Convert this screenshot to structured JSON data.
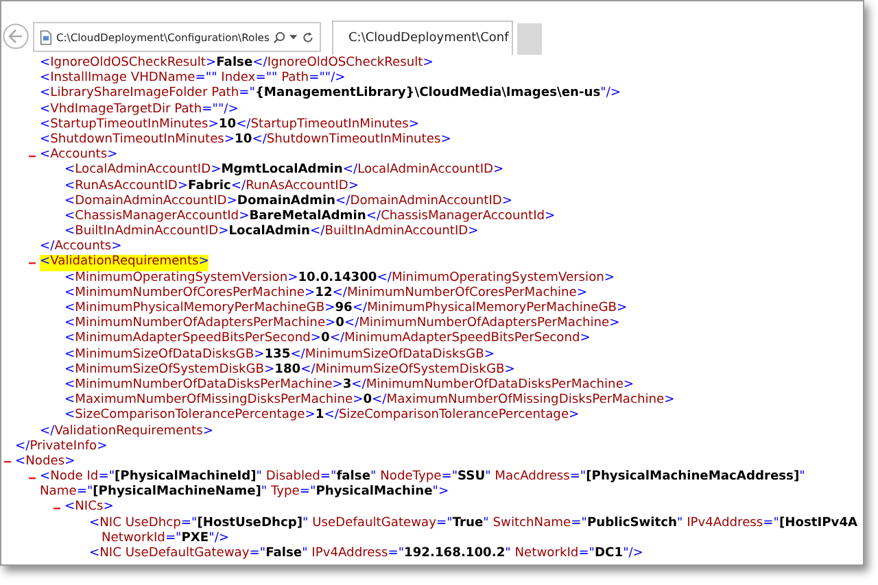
{
  "browser": {
    "address": "C:\\CloudDeployment\\Configuration\\Roles",
    "tab": {
      "title": "C:\\CloudDeployment\\Conf",
      "selected": true
    }
  },
  "document": {
    "nodes": [
      {
        "children": [
          {
            "highlighted": false,
            "lines": [
              [
                {
                  "kind": "punct",
                  "text": "<"
                },
                {
                  "kind": "name",
                  "text": "IgnoreOldOSCheckResult"
                },
                {
                  "kind": "punct",
                  "text": ">"
                },
                {
                  "kind": "value",
                  "text": "False"
                },
                {
                  "kind": "punct",
                  "text": "</"
                },
                {
                  "kind": "name",
                  "text": "IgnoreOldOSCheckResult"
                },
                {
                  "kind": "punct",
                  "text": ">"
                }
              ]
            ]
          },
          {
            "highlighted": false,
            "lines": [
              [
                {
                  "kind": "punct",
                  "text": "<"
                },
                {
                  "kind": "name",
                  "text": "InstallImage"
                },
                {
                  "kind": "attr",
                  "text": " VHDName"
                },
                {
                  "kind": "punct",
                  "text": "=\"\""
                },
                {
                  "kind": "attr",
                  "text": " Index"
                },
                {
                  "kind": "punct",
                  "text": "=\"\""
                },
                {
                  "kind": "attr",
                  "text": " Path"
                },
                {
                  "kind": "punct",
                  "text": "=\"\"/>"
                }
              ]
            ]
          },
          {
            "highlighted": false,
            "lines": [
              [
                {
                  "kind": "punct",
                  "text": "<"
                },
                {
                  "kind": "name",
                  "text": "LibraryShareImageFolder"
                },
                {
                  "kind": "attr",
                  "text": " Path"
                },
                {
                  "kind": "punct",
                  "text": "=\""
                },
                {
                  "kind": "value",
                  "text": "{ManagementLibrary}\\CloudMedia\\Images\\en-us"
                },
                {
                  "kind": "punct",
                  "text": "\"/>"
                }
              ]
            ]
          },
          {
            "highlighted": false,
            "lines": [
              [
                {
                  "kind": "punct",
                  "text": "<"
                },
                {
                  "kind": "name",
                  "text": "VhdImageTargetDir"
                },
                {
                  "kind": "attr",
                  "text": " Path"
                },
                {
                  "kind": "punct",
                  "text": "=\"\"/>"
                }
              ]
            ]
          },
          {
            "highlighted": false,
            "lines": [
              [
                {
                  "kind": "punct",
                  "text": "<"
                },
                {
                  "kind": "name",
                  "text": "StartupTimeoutInMinutes"
                },
                {
                  "kind": "punct",
                  "text": ">"
                },
                {
                  "kind": "value",
                  "text": "10"
                },
                {
                  "kind": "punct",
                  "text": "</"
                },
                {
                  "kind": "name",
                  "text": "StartupTimeoutInMinutes"
                },
                {
                  "kind": "punct",
                  "text": ">"
                }
              ]
            ]
          },
          {
            "highlighted": false,
            "lines": [
              [
                {
                  "kind": "punct",
                  "text": "<"
                },
                {
                  "kind": "name",
                  "text": "ShutdownTimeoutInMinutes"
                },
                {
                  "kind": "punct",
                  "text": ">"
                },
                {
                  "kind": "value",
                  "text": "10"
                },
                {
                  "kind": "punct",
                  "text": "</"
                },
                {
                  "kind": "name",
                  "text": "ShutdownTimeoutInMinutes"
                },
                {
                  "kind": "punct",
                  "text": ">"
                }
              ]
            ]
          },
          {
            "highlighted": false,
            "expanded": true,
            "lines": [
              [
                {
                  "kind": "punct",
                  "text": "<"
                },
                {
                  "kind": "name",
                  "text": "Accounts"
                },
                {
                  "kind": "punct",
                  "text": ">"
                }
              ]
            ],
            "children": [
              {
                "highlighted": false,
                "lines": [
                  [
                    {
                      "kind": "punct",
                      "text": "<"
                    },
                    {
                      "kind": "name",
                      "text": "LocalAdminAccountID"
                    },
                    {
                      "kind": "punct",
                      "text": ">"
                    },
                    {
                      "kind": "value",
                      "text": "MgmtLocalAdmin"
                    },
                    {
                      "kind": "punct",
                      "text": "</"
                    },
                    {
                      "kind": "name",
                      "text": "LocalAdminAccountID"
                    },
                    {
                      "kind": "punct",
                      "text": ">"
                    }
                  ]
                ]
              },
              {
                "highlighted": false,
                "lines": [
                  [
                    {
                      "kind": "punct",
                      "text": "<"
                    },
                    {
                      "kind": "name",
                      "text": "RunAsAccountID"
                    },
                    {
                      "kind": "punct",
                      "text": ">"
                    },
                    {
                      "kind": "value",
                      "text": "Fabric"
                    },
                    {
                      "kind": "punct",
                      "text": "</"
                    },
                    {
                      "kind": "name",
                      "text": "RunAsAccountID"
                    },
                    {
                      "kind": "punct",
                      "text": ">"
                    }
                  ]
                ]
              },
              {
                "highlighted": false,
                "lines": [
                  [
                    {
                      "kind": "punct",
                      "text": "<"
                    },
                    {
                      "kind": "name",
                      "text": "DomainAdminAccountID"
                    },
                    {
                      "kind": "punct",
                      "text": ">"
                    },
                    {
                      "kind": "value",
                      "text": "DomainAdmin"
                    },
                    {
                      "kind": "punct",
                      "text": "</"
                    },
                    {
                      "kind": "name",
                      "text": "DomainAdminAccountID"
                    },
                    {
                      "kind": "punct",
                      "text": ">"
                    }
                  ]
                ]
              },
              {
                "highlighted": false,
                "lines": [
                  [
                    {
                      "kind": "punct",
                      "text": "<"
                    },
                    {
                      "kind": "name",
                      "text": "ChassisManagerAccountId"
                    },
                    {
                      "kind": "punct",
                      "text": ">"
                    },
                    {
                      "kind": "value",
                      "text": "BareMetalAdmin"
                    },
                    {
                      "kind": "punct",
                      "text": "</"
                    },
                    {
                      "kind": "name",
                      "text": "ChassisManagerAccountId"
                    },
                    {
                      "kind": "punct",
                      "text": ">"
                    }
                  ]
                ]
              },
              {
                "highlighted": false,
                "lines": [
                  [
                    {
                      "kind": "punct",
                      "text": "<"
                    },
                    {
                      "kind": "name",
                      "text": "BuiltInAdminAccountID"
                    },
                    {
                      "kind": "punct",
                      "text": ">"
                    },
                    {
                      "kind": "value",
                      "text": "LocalAdmin"
                    },
                    {
                      "kind": "punct",
                      "text": "</"
                    },
                    {
                      "kind": "name",
                      "text": "BuiltInAdminAccountID"
                    },
                    {
                      "kind": "punct",
                      "text": ">"
                    }
                  ]
                ]
              }
            ],
            "close": [
              {
                "kind": "punct",
                "text": "</"
              },
              {
                "kind": "name",
                "text": "Accounts"
              },
              {
                "kind": "punct",
                "text": ">"
              }
            ]
          },
          {
            "highlighted": true,
            "expanded": true,
            "lines": [
              [
                {
                  "kind": "punct",
                  "text": "<"
                },
                {
                  "kind": "name",
                  "text": "ValidationRequirements"
                },
                {
                  "kind": "punct",
                  "text": ">"
                }
              ]
            ],
            "children": [
              {
                "highlighted": false,
                "lines": [
                  [
                    {
                      "kind": "punct",
                      "text": "<"
                    },
                    {
                      "kind": "name",
                      "text": "MinimumOperatingSystemVersion"
                    },
                    {
                      "kind": "punct",
                      "text": ">"
                    },
                    {
                      "kind": "value",
                      "text": "10.0.14300"
                    },
                    {
                      "kind": "punct",
                      "text": "</"
                    },
                    {
                      "kind": "name",
                      "text": "MinimumOperatingSystemVersion"
                    },
                    {
                      "kind": "punct",
                      "text": ">"
                    }
                  ]
                ]
              },
              {
                "highlighted": false,
                "lines": [
                  [
                    {
                      "kind": "punct",
                      "text": "<"
                    },
                    {
                      "kind": "name",
                      "text": "MinimumNumberOfCoresPerMachine"
                    },
                    {
                      "kind": "punct",
                      "text": ">"
                    },
                    {
                      "kind": "value",
                      "text": "12"
                    },
                    {
                      "kind": "punct",
                      "text": "</"
                    },
                    {
                      "kind": "name",
                      "text": "MinimumNumberOfCoresPerMachine"
                    },
                    {
                      "kind": "punct",
                      "text": ">"
                    }
                  ]
                ]
              },
              {
                "highlighted": false,
                "lines": [
                  [
                    {
                      "kind": "punct",
                      "text": "<"
                    },
                    {
                      "kind": "name",
                      "text": "MinimumPhysicalMemoryPerMachineGB"
                    },
                    {
                      "kind": "punct",
                      "text": ">"
                    },
                    {
                      "kind": "value",
                      "text": "96"
                    },
                    {
                      "kind": "punct",
                      "text": "</"
                    },
                    {
                      "kind": "name",
                      "text": "MinimumPhysicalMemoryPerMachineGB"
                    },
                    {
                      "kind": "punct",
                      "text": ">"
                    }
                  ]
                ]
              },
              {
                "highlighted": false,
                "lines": [
                  [
                    {
                      "kind": "punct",
                      "text": "<"
                    },
                    {
                      "kind": "name",
                      "text": "MinimumNumberOfAdaptersPerMachine"
                    },
                    {
                      "kind": "punct",
                      "text": ">"
                    },
                    {
                      "kind": "value",
                      "text": "0"
                    },
                    {
                      "kind": "punct",
                      "text": "</"
                    },
                    {
                      "kind": "name",
                      "text": "MinimumNumberOfAdaptersPerMachine"
                    },
                    {
                      "kind": "punct",
                      "text": ">"
                    }
                  ]
                ]
              },
              {
                "highlighted": false,
                "lines": [
                  [
                    {
                      "kind": "punct",
                      "text": "<"
                    },
                    {
                      "kind": "name",
                      "text": "MinimumAdapterSpeedBitsPerSecond"
                    },
                    {
                      "kind": "punct",
                      "text": ">"
                    },
                    {
                      "kind": "value",
                      "text": "0"
                    },
                    {
                      "kind": "punct",
                      "text": "</"
                    },
                    {
                      "kind": "name",
                      "text": "MinimumAdapterSpeedBitsPerSecond"
                    },
                    {
                      "kind": "punct",
                      "text": ">"
                    }
                  ]
                ]
              },
              {
                "highlighted": false,
                "lines": [
                  [
                    {
                      "kind": "punct",
                      "text": "<"
                    },
                    {
                      "kind": "name",
                      "text": "MinimumSizeOfDataDisksGB"
                    },
                    {
                      "kind": "punct",
                      "text": ">"
                    },
                    {
                      "kind": "value",
                      "text": "135"
                    },
                    {
                      "kind": "punct",
                      "text": "</"
                    },
                    {
                      "kind": "name",
                      "text": "MinimumSizeOfDataDisksGB"
                    },
                    {
                      "kind": "punct",
                      "text": ">"
                    }
                  ]
                ]
              },
              {
                "highlighted": false,
                "lines": [
                  [
                    {
                      "kind": "punct",
                      "text": "<"
                    },
                    {
                      "kind": "name",
                      "text": "MinimumSizeOfSystemDiskGB"
                    },
                    {
                      "kind": "punct",
                      "text": ">"
                    },
                    {
                      "kind": "value",
                      "text": "180"
                    },
                    {
                      "kind": "punct",
                      "text": "</"
                    },
                    {
                      "kind": "name",
                      "text": "MinimumSizeOfSystemDiskGB"
                    },
                    {
                      "kind": "punct",
                      "text": ">"
                    }
                  ]
                ]
              },
              {
                "highlighted": false,
                "lines": [
                  [
                    {
                      "kind": "punct",
                      "text": "<"
                    },
                    {
                      "kind": "name",
                      "text": "MinimumNumberOfDataDisksPerMachine"
                    },
                    {
                      "kind": "punct",
                      "text": ">"
                    },
                    {
                      "kind": "value",
                      "text": "3"
                    },
                    {
                      "kind": "punct",
                      "text": "</"
                    },
                    {
                      "kind": "name",
                      "text": "MinimumNumberOfDataDisksPerMachine"
                    },
                    {
                      "kind": "punct",
                      "text": ">"
                    }
                  ]
                ]
              },
              {
                "highlighted": false,
                "lines": [
                  [
                    {
                      "kind": "punct",
                      "text": "<"
                    },
                    {
                      "kind": "name",
                      "text": "MaximumNumberOfMissingDisksPerMachine"
                    },
                    {
                      "kind": "punct",
                      "text": ">"
                    },
                    {
                      "kind": "value",
                      "text": "0"
                    },
                    {
                      "kind": "punct",
                      "text": "</"
                    },
                    {
                      "kind": "name",
                      "text": "MaximumNumberOfMissingDisksPerMachine"
                    },
                    {
                      "kind": "punct",
                      "text": ">"
                    }
                  ]
                ]
              },
              {
                "highlighted": false,
                "lines": [
                  [
                    {
                      "kind": "punct",
                      "text": "<"
                    },
                    {
                      "kind": "name",
                      "text": "SizeComparisonTolerancePercentage"
                    },
                    {
                      "kind": "punct",
                      "text": ">"
                    },
                    {
                      "kind": "value",
                      "text": "1"
                    },
                    {
                      "kind": "punct",
                      "text": "</"
                    },
                    {
                      "kind": "name",
                      "text": "SizeComparisonTolerancePercentage"
                    },
                    {
                      "kind": "punct",
                      "text": ">"
                    }
                  ]
                ]
              }
            ],
            "close": [
              {
                "kind": "punct",
                "text": "</"
              },
              {
                "kind": "name",
                "text": "ValidationRequirements"
              },
              {
                "kind": "punct",
                "text": ">"
              }
            ]
          }
        ],
        "close": [
          {
            "kind": "punct",
            "text": "</"
          },
          {
            "kind": "name",
            "text": "PrivateInfo"
          },
          {
            "kind": "punct",
            "text": ">"
          }
        ]
      },
      {
        "highlighted": false,
        "expanded": true,
        "lines": [
          [
            {
              "kind": "punct",
              "text": "<"
            },
            {
              "kind": "name",
              "text": "Nodes"
            },
            {
              "kind": "punct",
              "text": ">"
            }
          ]
        ],
        "children": [
          {
            "highlighted": false,
            "expanded": true,
            "lines": [
              [
                {
                  "kind": "punct",
                  "text": "<"
                },
                {
                  "kind": "name",
                  "text": "Node"
                },
                {
                  "kind": "attr",
                  "text": " Id"
                },
                {
                  "kind": "punct",
                  "text": "=\""
                },
                {
                  "kind": "value",
                  "text": "[PhysicalMachineId]"
                },
                {
                  "kind": "punct",
                  "text": "\""
                },
                {
                  "kind": "attr",
                  "text": " Disabled"
                },
                {
                  "kind": "punct",
                  "text": "=\""
                },
                {
                  "kind": "value",
                  "text": "false"
                },
                {
                  "kind": "punct",
                  "text": "\""
                },
                {
                  "kind": "attr",
                  "text": " NodeType"
                },
                {
                  "kind": "punct",
                  "text": "=\""
                },
                {
                  "kind": "value",
                  "text": "SSU"
                },
                {
                  "kind": "punct",
                  "text": "\""
                },
                {
                  "kind": "attr",
                  "text": " MacAddress"
                },
                {
                  "kind": "punct",
                  "text": "=\""
                },
                {
                  "kind": "value",
                  "text": "[PhysicalMachineMacAddress]"
                },
                {
                  "kind": "punct",
                  "text": "\""
                }
              ],
              [
                {
                  "kind": "attr",
                  "text": "Name"
                },
                {
                  "kind": "punct",
                  "text": "=\""
                },
                {
                  "kind": "value",
                  "text": "[PhysicalMachineName]"
                },
                {
                  "kind": "punct",
                  "text": "\""
                },
                {
                  "kind": "attr",
                  "text": " Type"
                },
                {
                  "kind": "punct",
                  "text": "=\""
                },
                {
                  "kind": "value",
                  "text": "PhysicalMachine"
                },
                {
                  "kind": "punct",
                  "text": "\">"
                }
              ]
            ],
            "children": [
              {
                "highlighted": false,
                "expanded": true,
                "lines": [
                  [
                    {
                      "kind": "punct",
                      "text": "<"
                    },
                    {
                      "kind": "name",
                      "text": "NICs"
                    },
                    {
                      "kind": "punct",
                      "text": ">"
                    }
                  ]
                ],
                "children": [
                  {
                    "highlighted": false,
                    "lines": [
                      [
                        {
                          "kind": "punct",
                          "text": "<"
                        },
                        {
                          "kind": "name",
                          "text": "NIC"
                        },
                        {
                          "kind": "attr",
                          "text": " UseDhcp"
                        },
                        {
                          "kind": "punct",
                          "text": "=\""
                        },
                        {
                          "kind": "value",
                          "text": "[HostUseDhcp]"
                        },
                        {
                          "kind": "punct",
                          "text": "\""
                        },
                        {
                          "kind": "attr",
                          "text": " UseDefaultGateway"
                        },
                        {
                          "kind": "punct",
                          "text": "=\""
                        },
                        {
                          "kind": "value",
                          "text": "True"
                        },
                        {
                          "kind": "punct",
                          "text": "\""
                        },
                        {
                          "kind": "attr",
                          "text": " SwitchName"
                        },
                        {
                          "kind": "punct",
                          "text": "=\""
                        },
                        {
                          "kind": "value",
                          "text": "PublicSwitch"
                        },
                        {
                          "kind": "punct",
                          "text": "\""
                        },
                        {
                          "kind": "attr",
                          "text": " IPv4Address"
                        },
                        {
                          "kind": "punct",
                          "text": "=\""
                        },
                        {
                          "kind": "value",
                          "text": "[HostIPv4A"
                        }
                      ],
                      [
                        {
                          "kind": "attr",
                          "text": "NetworkId"
                        },
                        {
                          "kind": "punct",
                          "text": "=\""
                        },
                        {
                          "kind": "value",
                          "text": "PXE"
                        },
                        {
                          "kind": "punct",
                          "text": "\"/>"
                        }
                      ]
                    ]
                  },
                  {
                    "highlighted": false,
                    "lines": [
                      [
                        {
                          "kind": "punct",
                          "text": "<"
                        },
                        {
                          "kind": "name",
                          "text": "NIC"
                        },
                        {
                          "kind": "attr",
                          "text": " UseDefaultGateway"
                        },
                        {
                          "kind": "punct",
                          "text": "=\""
                        },
                        {
                          "kind": "value",
                          "text": "False"
                        },
                        {
                          "kind": "punct",
                          "text": "\""
                        },
                        {
                          "kind": "attr",
                          "text": " IPv4Address"
                        },
                        {
                          "kind": "punct",
                          "text": "=\""
                        },
                        {
                          "kind": "value",
                          "text": "192.168.100.2"
                        },
                        {
                          "kind": "punct",
                          "text": "\""
                        },
                        {
                          "kind": "attr",
                          "text": " NetworkId"
                        },
                        {
                          "kind": "punct",
                          "text": "=\""
                        },
                        {
                          "kind": "value",
                          "text": "DC1"
                        },
                        {
                          "kind": "punct",
                          "text": "\"/>"
                        }
                      ]
                    ]
                  }
                ]
              }
            ]
          }
        ]
      }
    ]
  }
}
